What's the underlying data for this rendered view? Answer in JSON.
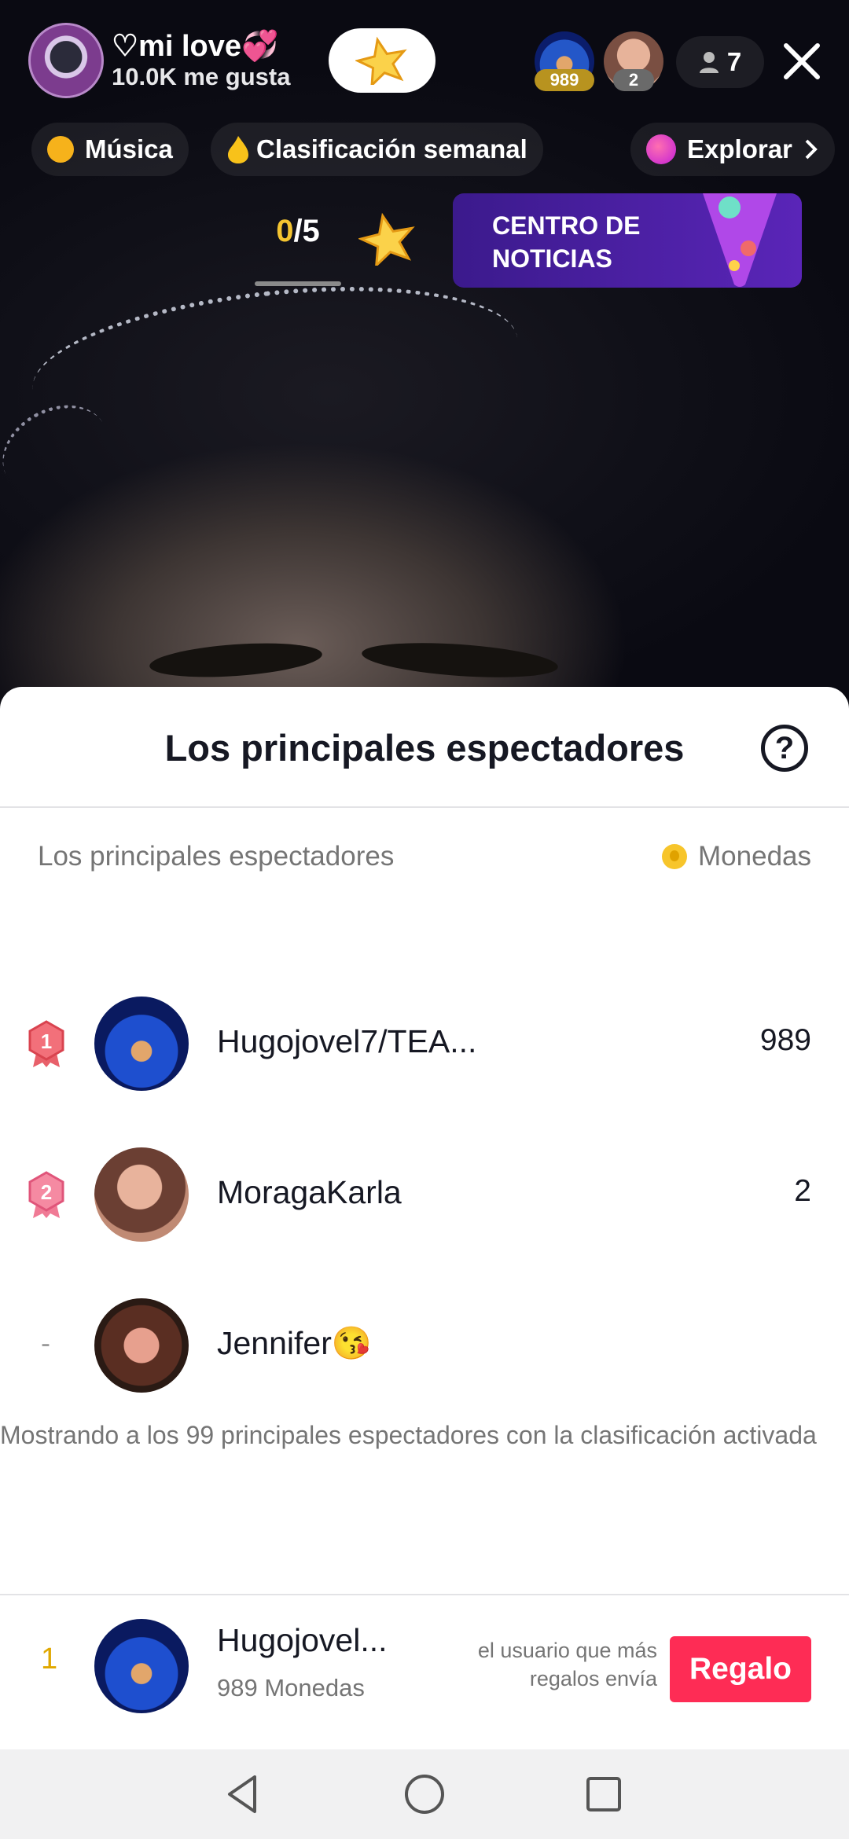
{
  "host": {
    "name": "♡mi love💞",
    "likes": "10.0K me gusta"
  },
  "header": {
    "top_viewers": [
      {
        "badge": "989"
      },
      {
        "badge": "2"
      }
    ],
    "viewer_count": "7"
  },
  "chips": {
    "music": "Música",
    "weekly": "Clasificación semanal",
    "explore": "Explorar"
  },
  "goal": {
    "done": "0",
    "total": "/5",
    "progress": 0
  },
  "news": {
    "line1": "CENTRO DE",
    "line2": "NOTICIAS"
  },
  "sheet": {
    "title": "Los principales espectadores",
    "col_left": "Los principales espectadores",
    "col_right": "Monedas",
    "rows": [
      {
        "rank": "1",
        "name": "Hugojovel7/TEA...",
        "coins": "989"
      },
      {
        "rank": "2",
        "name": "MoragaKarla",
        "coins": "2"
      },
      {
        "rank": "-",
        "name": "Jennifer😘",
        "coins": ""
      }
    ],
    "footer_note": "Mostrando a los 99 principales espectadores con la clasificación activada"
  },
  "me": {
    "rank": "1",
    "name": "Hugojovel...",
    "coins": "989 Monedas",
    "hint": "el usuario que más regalos envía",
    "gift_label": "Regalo"
  },
  "colors": {
    "accent": "#fe2c55",
    "gold": "#f4c430",
    "news_bg": "#4a1fa8"
  },
  "icons": [
    "star-icon",
    "person-icon",
    "close-icon",
    "hashtag-icon",
    "flame-icon",
    "planet-icon",
    "chevron-right-icon",
    "help-icon",
    "coin-icon",
    "medal-icon",
    "back-icon",
    "home-icon",
    "recents-icon"
  ]
}
